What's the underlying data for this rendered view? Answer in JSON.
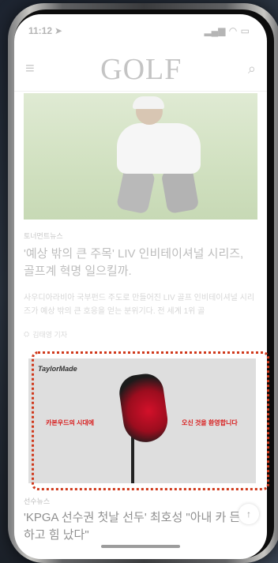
{
  "status": {
    "time": "11:12"
  },
  "header": {
    "logo": "GOLF"
  },
  "article1": {
    "category": "토너먼트뉴스",
    "title": "'예상 밖의 큰 주목' LIV 인비테이셔널 시리즈, 골프계 혁명 일으킬까.",
    "excerpt": "사우디아라비아 국부펀드 주도로 만들어진 LIV 골프 인비테이셔널 시리즈가 예상 밖의 큰 호응을 얻는 분위기다. 전 세계 1위 골",
    "byline": "김태영 기자"
  },
  "ad": {
    "brand": "TaylorMade",
    "left_text": "카본우드의 시대에",
    "right_text": "오신 것을 환영합니다"
  },
  "article2": {
    "category": "선수뉴스",
    "title": "'KPGA 선수권 첫날 선두' 최호성 \"아내 카 든든하고 힘 났다\""
  },
  "colors": {
    "ad_outline": "#d0391c",
    "ad_red": "#d81b1b"
  }
}
